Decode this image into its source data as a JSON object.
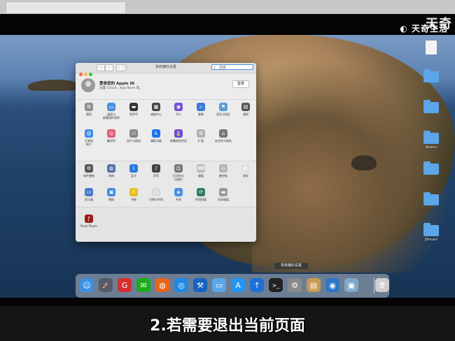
{
  "watermark": {
    "brand": "天奇生活",
    "corner": "天奇"
  },
  "window": {
    "title": "系统偏好设置",
    "search_placeholder": "搜索",
    "back": "‹",
    "forward": "›",
    "grid": "⋮⋮⋮",
    "apple_id": {
      "title": "登录您的 Apple ID",
      "subtitle": "设置 iCloud、App Store 等。",
      "login": "登录"
    },
    "section1": [
      {
        "label": "通用",
        "icon": "general-icon",
        "color": "#8e8e93",
        "glyph": "⚙"
      },
      {
        "label": "桌面与\n屏幕保护程序",
        "icon": "desktop-icon",
        "color": "#4a90e2",
        "glyph": "▭"
      },
      {
        "label": "程序坞",
        "icon": "dock-icon",
        "color": "#333333",
        "glyph": "▬"
      },
      {
        "label": "调度中心",
        "icon": "mission-control-icon",
        "color": "#444444",
        "glyph": "▦"
      },
      {
        "label": "Siri",
        "icon": "siri-icon",
        "color": "#7b4fd6",
        "glyph": "◉"
      },
      {
        "label": "聚焦",
        "icon": "spotlight-icon",
        "color": "#3a7bd5",
        "glyph": "⌕"
      },
      {
        "label": "语言与地区",
        "icon": "language-icon",
        "color": "#5b9bd5",
        "glyph": "⚑"
      },
      {
        "label": "通知",
        "icon": "notifications-icon",
        "color": "#555555",
        "glyph": "▤"
      }
    ],
    "section1b": [
      {
        "label": "互联网\n帐户",
        "icon": "internet-accounts-icon",
        "color": "#3a8ee6",
        "glyph": "@"
      },
      {
        "label": "触控ID",
        "icon": "touch-id-icon",
        "color": "#e35d7a",
        "glyph": "◎"
      },
      {
        "label": "用户与群组",
        "icon": "users-icon",
        "color": "#888888",
        "glyph": "⚇"
      },
      {
        "label": "辅助功能",
        "icon": "accessibility-icon",
        "color": "#1a73e8",
        "glyph": "♿"
      },
      {
        "label": "屏幕使用时间",
        "icon": "screen-time-icon",
        "color": "#6a4bd8",
        "glyph": "⌛"
      },
      {
        "label": "扩展",
        "icon": "extensions-icon",
        "color": "#b0b0b0",
        "glyph": "⧉"
      },
      {
        "label": "安全性与隐私",
        "icon": "security-icon",
        "color": "#777777",
        "glyph": "⌂"
      }
    ],
    "section2": [
      {
        "label": "软件更新",
        "icon": "software-update-icon",
        "color": "#555555",
        "glyph": "⚙"
      },
      {
        "label": "网络",
        "icon": "network-icon",
        "color": "#5b6fa8",
        "glyph": "◍"
      },
      {
        "label": "蓝牙",
        "icon": "bluetooth-icon",
        "color": "#2a7ae2",
        "glyph": "ᛒ"
      },
      {
        "label": "声音",
        "icon": "sound-icon",
        "color": "#444444",
        "glyph": "♪"
      },
      {
        "label": "打印机与\n扫描仪",
        "icon": "printer-icon",
        "color": "#777777",
        "glyph": "⎙"
      },
      {
        "label": "键盘",
        "icon": "keyboard-icon",
        "color": "#bdbdbd",
        "glyph": "⌨"
      },
      {
        "label": "触控板",
        "icon": "trackpad-icon",
        "color": "#b5b5b5",
        "glyph": "▭"
      },
      {
        "label": "鼠标",
        "icon": "mouse-icon",
        "color": "#e0e0e0",
        "glyph": "◐"
      }
    ],
    "section2b": [
      {
        "label": "显示器",
        "icon": "displays-icon",
        "color": "#4a7bc8",
        "glyph": "▭"
      },
      {
        "label": "随航",
        "icon": "sidecar-icon",
        "color": "#3b8de0",
        "glyph": "▣"
      },
      {
        "label": "节能",
        "icon": "energy-saver-icon",
        "color": "#e8c020",
        "glyph": "☼"
      },
      {
        "label": "日期与时间",
        "icon": "date-time-icon",
        "color": "#d9d9d9",
        "glyph": "◷"
      },
      {
        "label": "共享",
        "icon": "sharing-icon",
        "color": "#4a90e2",
        "glyph": "◈"
      },
      {
        "label": "时间机器",
        "icon": "time-machine-icon",
        "color": "#2f7f5f",
        "glyph": "⟳"
      },
      {
        "label": "启动磁盘",
        "icon": "startup-disk-icon",
        "color": "#9a9a9a",
        "glyph": "▬"
      }
    ],
    "section3": [
      {
        "label": "Flash Player",
        "icon": "flash-player-icon",
        "color": "#9b1c1c",
        "glyph": "ƒ"
      }
    ]
  },
  "desktop": [
    {
      "label": "",
      "kind": "doc"
    },
    {
      "label": "",
      "kind": "folder"
    },
    {
      "label": "",
      "kind": "folder"
    },
    {
      "label": "Weather",
      "kind": "folder"
    },
    {
      "label": "",
      "kind": "folder"
    },
    {
      "label": "",
      "kind": "folder"
    },
    {
      "label": "JDProject",
      "kind": "folder"
    }
  ],
  "dock": {
    "tooltip": "系统偏好设置",
    "apps": [
      {
        "name": "finder-icon",
        "color": "#3d8fe0",
        "glyph": "☺"
      },
      {
        "name": "launchpad-icon",
        "color": "#555b66",
        "glyph": "🚀"
      },
      {
        "name": "toutiao-icon",
        "color": "#d32f2f",
        "glyph": "G"
      },
      {
        "name": "wechat-icon",
        "color": "#1aad19",
        "glyph": "✉"
      },
      {
        "name": "firefox-icon",
        "color": "#e8641b",
        "glyph": "◍"
      },
      {
        "name": "safari-icon",
        "color": "#1e88e5",
        "glyph": "◎"
      },
      {
        "name": "xcode-icon",
        "color": "#1565c0",
        "glyph": "⚒"
      },
      {
        "name": "folder-icon",
        "color": "#5aa6e8",
        "glyph": "▭"
      },
      {
        "name": "app-store-icon",
        "color": "#2196f3",
        "glyph": "A"
      },
      {
        "name": "upload-icon",
        "color": "#1e6fd9",
        "glyph": "↑"
      },
      {
        "name": "terminal-icon",
        "color": "#222222",
        "glyph": ">_"
      },
      {
        "name": "system-preferences-icon",
        "color": "#8a8a8a",
        "glyph": "⚙"
      },
      {
        "name": "notes-icon",
        "color": "#c79b55",
        "glyph": "▤"
      },
      {
        "name": "sourcetree-icon",
        "color": "#2e75c9",
        "glyph": "◉"
      },
      {
        "name": "preview-icon",
        "color": "#7fa7c9",
        "glyph": "▣"
      },
      {
        "name": "trash-icon",
        "color": "#cfcfcf",
        "glyph": "🗑"
      }
    ]
  },
  "caption": "2.若需要退出当前页面"
}
